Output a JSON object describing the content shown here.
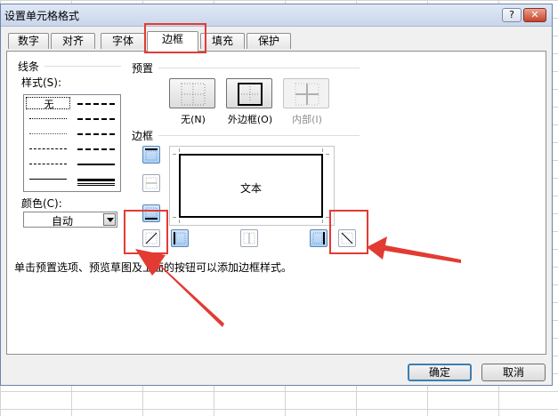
{
  "dialog": {
    "title": "设置单元格格式",
    "help_label": "?",
    "close_label": "✕"
  },
  "tabs": [
    {
      "label": "数字"
    },
    {
      "label": "对齐"
    },
    {
      "label": "字体"
    },
    {
      "label": "边框",
      "active": true
    },
    {
      "label": "填充"
    },
    {
      "label": "保护"
    }
  ],
  "line_group": {
    "title": "线条",
    "style_label": "样式(S):",
    "none_label": "无",
    "color_label": "颜色(C):",
    "color_value": "自动"
  },
  "preset_group": {
    "title": "预置",
    "none": "无(N)",
    "outline": "外边框(O)",
    "inside": "内部(I)"
  },
  "border_group": {
    "title": "边框",
    "preview_text": "文本"
  },
  "hint": "单击预置选项、预览草图及上面的按钮可以添加边框样式。",
  "buttons": {
    "ok": "确定",
    "cancel": "取消"
  },
  "colors": {
    "annotation_red": "#e23b33",
    "selected_blue": "#a9cdf3"
  },
  "icons": {
    "help": "help-icon",
    "close": "close-icon",
    "dropdown": "chevron-down-icon"
  }
}
